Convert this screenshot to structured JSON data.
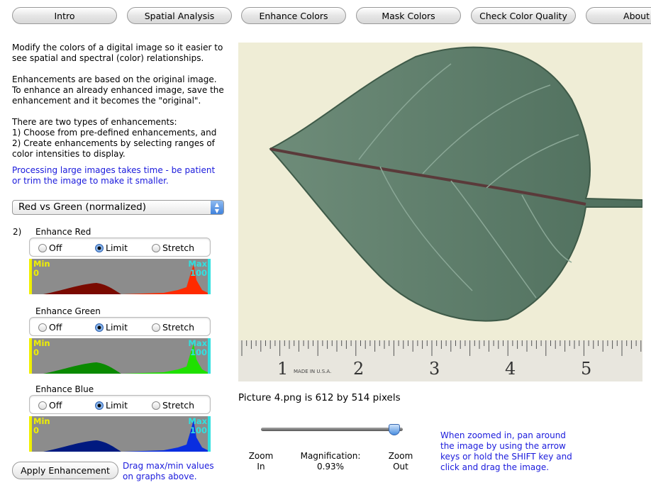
{
  "tabs": [
    "Intro",
    "Spatial Analysis",
    "Enhance Colors",
    "Mask Colors",
    "Check Color Quality",
    "About"
  ],
  "intro": {
    "p1": "Modify the colors of a digital image so it easier to see spatial and spectral (color) relationships.",
    "p2": "Enhancements are based on the original image.  To enhance an already enhanced image, save the enhancement and it becomes the \"original\".",
    "p3": "There are two types of enhancements:",
    "p3a": "1) Choose from pre-defined enhancements, and",
    "p3b": "2) Create enhancements by selecting ranges of color intensities to display.",
    "note": "Processing large images takes time - be patient or trim the image to make it smaller."
  },
  "preset": {
    "selected": "Red vs Green (normalized)"
  },
  "step_label": "2)",
  "channels": [
    {
      "label": "Enhance Red",
      "options": [
        "Off",
        "Limit",
        "Stretch"
      ],
      "selected": "Limit",
      "min_label": "Min",
      "min": "0",
      "max_label": "Max",
      "max": "100",
      "color": "#ff2a00",
      "dark": "#7a0a00"
    },
    {
      "label": "Enhance Green",
      "options": [
        "Off",
        "Limit",
        "Stretch"
      ],
      "selected": "Limit",
      "min_label": "Min",
      "min": "0",
      "max_label": "Max",
      "max": "100",
      "color": "#1fe000",
      "dark": "#0a8a00"
    },
    {
      "label": "Enhance Blue",
      "options": [
        "Off",
        "Limit",
        "Stretch"
      ],
      "selected": "Limit",
      "min_label": "Min",
      "min": "0",
      "max_label": "Max",
      "max": "100",
      "color": "#0a2ee0",
      "dark": "#001a80"
    }
  ],
  "apply_label": "Apply Enhancement",
  "drag_hint": "Drag max/min values on graphs above.",
  "image": {
    "caption": "Picture 4.png is 612 by 514 pixels",
    "ruler_text": "MADE IN U.S.A.",
    "ruler_numbers": [
      "1",
      "2",
      "3",
      "4",
      "5"
    ]
  },
  "zoom": {
    "in_label": "Zoom In",
    "out_label": "Zoom Out",
    "mag_label": "Magnification:",
    "mag_value": "0.93%",
    "slider_position": 0.95,
    "hint": "When zoomed in, pan around the image by using the arrow keys or hold the SHIFT key and click and drag the image."
  },
  "colors": {
    "min_marker": "#f0f000",
    "max_marker": "#30e0e0",
    "hint_text": "#1a1adc"
  }
}
